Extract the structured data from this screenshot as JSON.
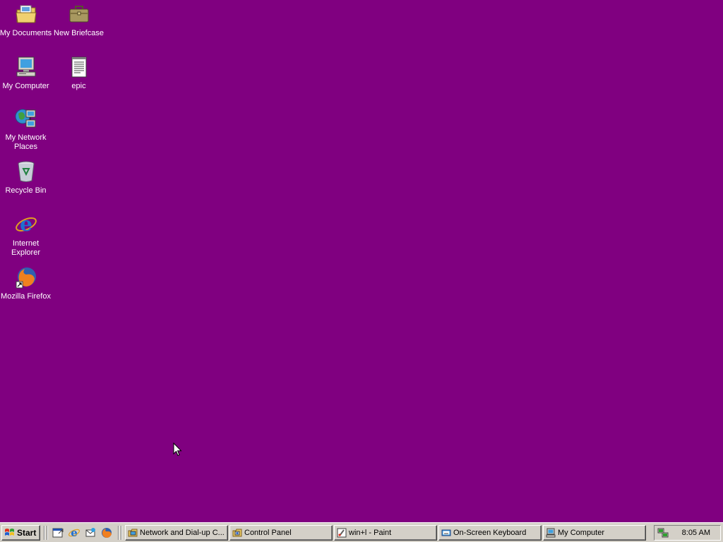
{
  "desktop": {
    "background_color": "#800080",
    "icons": [
      {
        "label": "My Documents",
        "icon": "folder-documents-icon"
      },
      {
        "label": "New Briefcase",
        "icon": "briefcase-icon"
      },
      {
        "label": "My Computer",
        "icon": "computer-icon"
      },
      {
        "label": "epic",
        "icon": "text-document-icon"
      },
      {
        "label": "My Network Places",
        "icon": "network-places-icon"
      },
      {
        "label": "Recycle Bin",
        "icon": "recycle-bin-icon"
      },
      {
        "label": "Internet Explorer",
        "icon": "internet-explorer-icon"
      },
      {
        "label": "Mozilla Firefox",
        "icon": "firefox-icon"
      }
    ]
  },
  "taskbar": {
    "start_label": "Start",
    "quick_launch": [
      "show-desktop-icon",
      "internet-explorer-icon",
      "outlook-express-icon",
      "firefox-icon"
    ],
    "tasks": [
      {
        "label": "Network and Dial-up C...",
        "icon": "network-folder-icon"
      },
      {
        "label": "Control Panel",
        "icon": "control-panel-icon"
      },
      {
        "label": "win+l - Paint",
        "icon": "paint-icon"
      },
      {
        "label": "On-Screen Keyboard",
        "icon": "keyboard-icon"
      },
      {
        "label": "My Computer",
        "icon": "computer-icon"
      }
    ],
    "tray": {
      "icon": "network-tray-icon",
      "clock": "8:05 AM"
    }
  }
}
